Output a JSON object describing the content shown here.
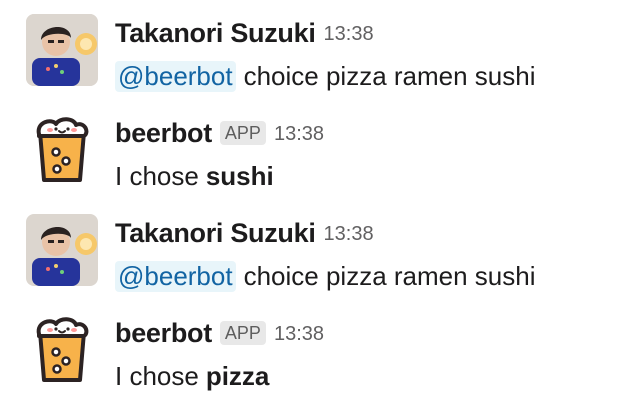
{
  "messages": [
    {
      "sender": "Takanori Suzuki",
      "time": "13:38",
      "avatar": "user-photo",
      "mention": "@beerbot",
      "text": "choice pizza ramen sushi"
    },
    {
      "sender": "beerbot",
      "badge": "APP",
      "time": "13:38",
      "avatar": "beer-icon",
      "prefix": "I chose",
      "choice": "sushi"
    },
    {
      "sender": "Takanori Suzuki",
      "time": "13:38",
      "avatar": "user-photo",
      "mention": "@beerbot",
      "text": "choice pizza ramen sushi"
    },
    {
      "sender": "beerbot",
      "badge": "APP",
      "time": "13:38",
      "avatar": "beer-icon",
      "prefix": "I chose",
      "choice": "pizza"
    }
  ],
  "colors": {
    "mention_bg": "#e8f5fa",
    "mention_text": "#1264a3",
    "badge_bg": "#e8e8e8",
    "beer": "#f7b24a",
    "text": "#1d1c1d",
    "timestamp": "#616061"
  }
}
